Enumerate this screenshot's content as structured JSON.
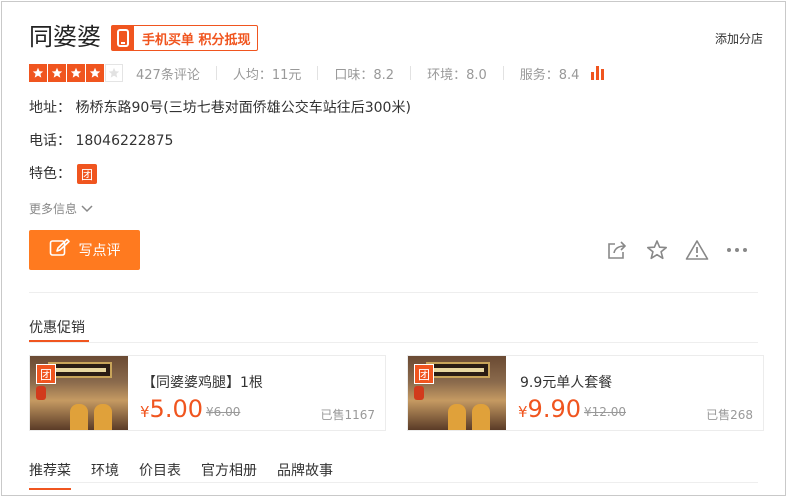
{
  "shop": {
    "title": "同婆婆",
    "pay_badge": "手机买单 积分抵现",
    "add_branch": "添加分店"
  },
  "rating": {
    "stars": 4,
    "stars_max": 5,
    "review_count": "427条评论",
    "avg_price": "人均：11元",
    "taste": "口味：8.2",
    "environment": "环境：8.0",
    "service": "服务：8.4"
  },
  "info": {
    "address": "地址：  杨桥东路90号(三坊七巷对面侨雄公交车站往后300米)",
    "phone": "电话：  18046222875",
    "features_label": "特色：",
    "features_badge": "团",
    "more_info": "更多信息"
  },
  "actions": {
    "write_review": "写点评"
  },
  "promotions": {
    "header": "优惠促销",
    "deals": [
      {
        "badge": "团",
        "name": "【同婆婆鸡腿】1根",
        "yen": "¥",
        "price": "5.00",
        "original": "¥6.00",
        "sold": "已售1167"
      },
      {
        "badge": "团",
        "name": "9.9元单人套餐",
        "yen": "¥",
        "price": "9.90",
        "original": "¥12.00",
        "sold": "已售268"
      }
    ]
  },
  "tabs": [
    "推荐菜",
    "环境",
    "价目表",
    "官方相册",
    "品牌故事"
  ],
  "colors": {
    "accent": "#f0551f",
    "button": "#ff7a1f"
  }
}
